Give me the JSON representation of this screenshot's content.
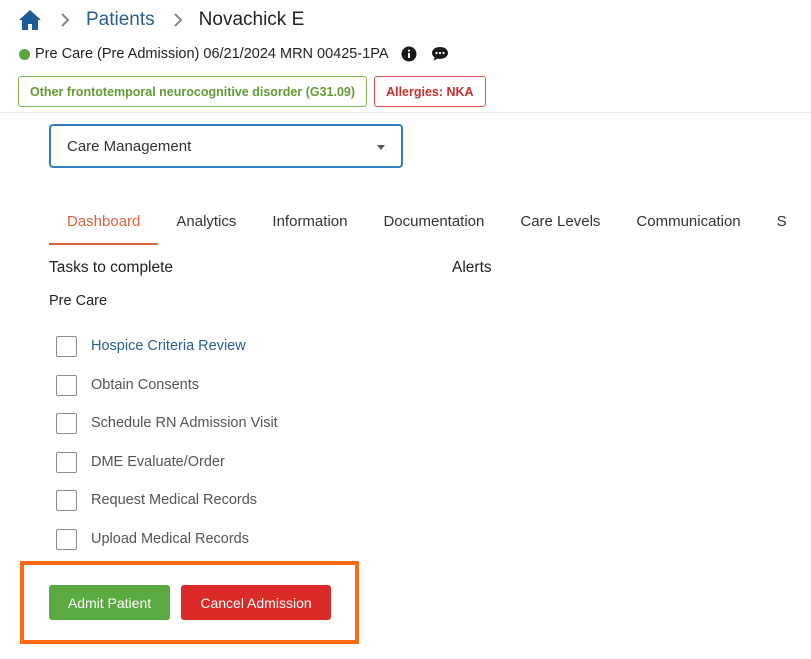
{
  "breadcrumb": {
    "home_icon": "home-icon",
    "separator_icon": "chevron-right-icon",
    "items": [
      "Patients",
      "Novachick E"
    ]
  },
  "patient": {
    "status": "Pre Care",
    "admission_info": "(Pre Admission) 06/21/2024 MRN 00425-1PA",
    "status_color": "#5aa63c",
    "icons": [
      "info-icon",
      "chat-icon"
    ]
  },
  "badges": {
    "diagnosis": "Other frontotemporal neurocognitive disorder (G31.09)",
    "allergies": "Allergies: NKA"
  },
  "program_select": {
    "selected": "Care Management"
  },
  "tabs": [
    "Dashboard",
    "Analytics",
    "Information",
    "Documentation",
    "Care Levels",
    "Communication",
    "S"
  ],
  "active_tab": "Dashboard",
  "tasks": {
    "title": "Tasks to complete",
    "group": "Pre Care",
    "items": [
      "Hospice Criteria Review",
      "Obtain Consents",
      "Schedule RN Admission Visit",
      "DME Evaluate/Order",
      "Request Medical Records",
      "Upload Medical Records"
    ]
  },
  "alerts": {
    "title": "Alerts"
  },
  "actions": {
    "admit": "Admit Patient",
    "cancel": "Cancel Admission"
  },
  "colors": {
    "accent_link": "#2a5e93",
    "active_tab": "#d9633b",
    "admit_button": "#5ba941",
    "cancel_button": "#dc2a28",
    "highlight_frame": "#ff6a13"
  }
}
